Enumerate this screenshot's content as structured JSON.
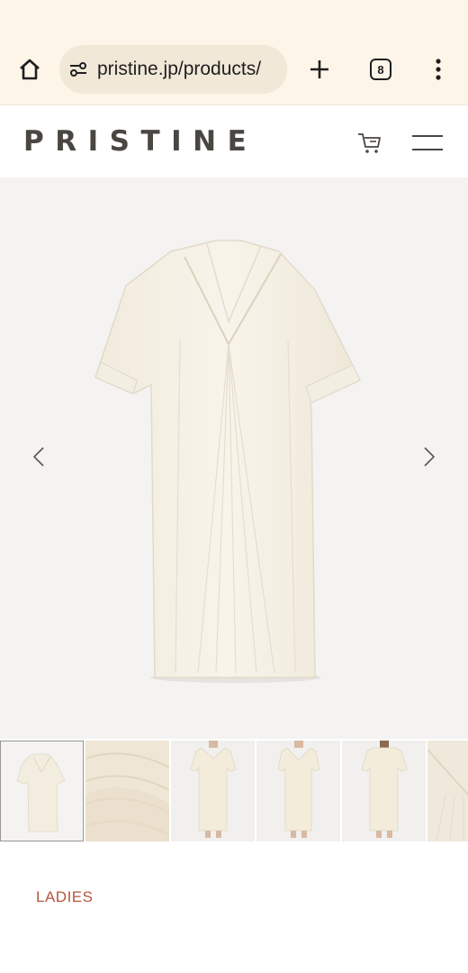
{
  "browser": {
    "url": "pristine.jp/products/",
    "tab_count": "8"
  },
  "site": {
    "logo": "PRISTINE"
  },
  "gallery": {
    "thumbnails": [
      {
        "label": "flat-dress"
      },
      {
        "label": "fabric-detail"
      },
      {
        "label": "model-front"
      },
      {
        "label": "model-front-2"
      },
      {
        "label": "model-back"
      },
      {
        "label": "collar-detail"
      }
    ]
  },
  "product": {
    "category": "LADIES"
  },
  "colors": {
    "browser_bg": "#fdf5e8",
    "url_pill": "#f1e8d8",
    "logo": "#4a4642",
    "category": "#b5563e",
    "dress": "#f5f0e4"
  }
}
